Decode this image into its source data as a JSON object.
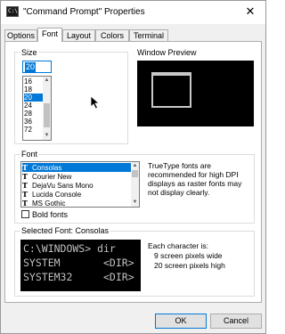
{
  "window": {
    "title": "\"Command Prompt\" Properties",
    "app_icon_text": "C:\\"
  },
  "tabs": [
    {
      "label": "Options"
    },
    {
      "label": "Font"
    },
    {
      "label": "Layout"
    },
    {
      "label": "Colors"
    },
    {
      "label": "Terminal"
    }
  ],
  "active_tab": "Font",
  "size": {
    "label": "Size",
    "input_value": "20",
    "items": [
      "16",
      "18",
      "20",
      "24",
      "28",
      "36",
      "72"
    ],
    "selected": "20"
  },
  "preview": {
    "label": "Window Preview"
  },
  "font": {
    "label": "Font",
    "items": [
      "Consolas",
      "Courier New",
      "DejaVu Sans Mono",
      "Lucida Console",
      "MS Gothic"
    ],
    "selected": "Consolas",
    "tt_glyph": "T",
    "note": "TrueType fonts are recommended for high DPI displays as raster fonts may not display clearly.",
    "bold_label": "Bold fonts"
  },
  "selected_font": {
    "label": "Selected Font: Consolas",
    "lines": [
      "C:\\WINDOWS> dir",
      "SYSTEM       <DIR>",
      "SYSTEM32     <DIR>"
    ],
    "char_info_title": "Each character is:",
    "char_width": "9 screen pixels wide",
    "char_height": "20 screen pixels high"
  },
  "buttons": {
    "ok": "OK",
    "cancel": "Cancel"
  },
  "colors": {
    "accent": "#0078d7",
    "console_bg": "#000000",
    "console_fg": "#c0c0c0"
  }
}
